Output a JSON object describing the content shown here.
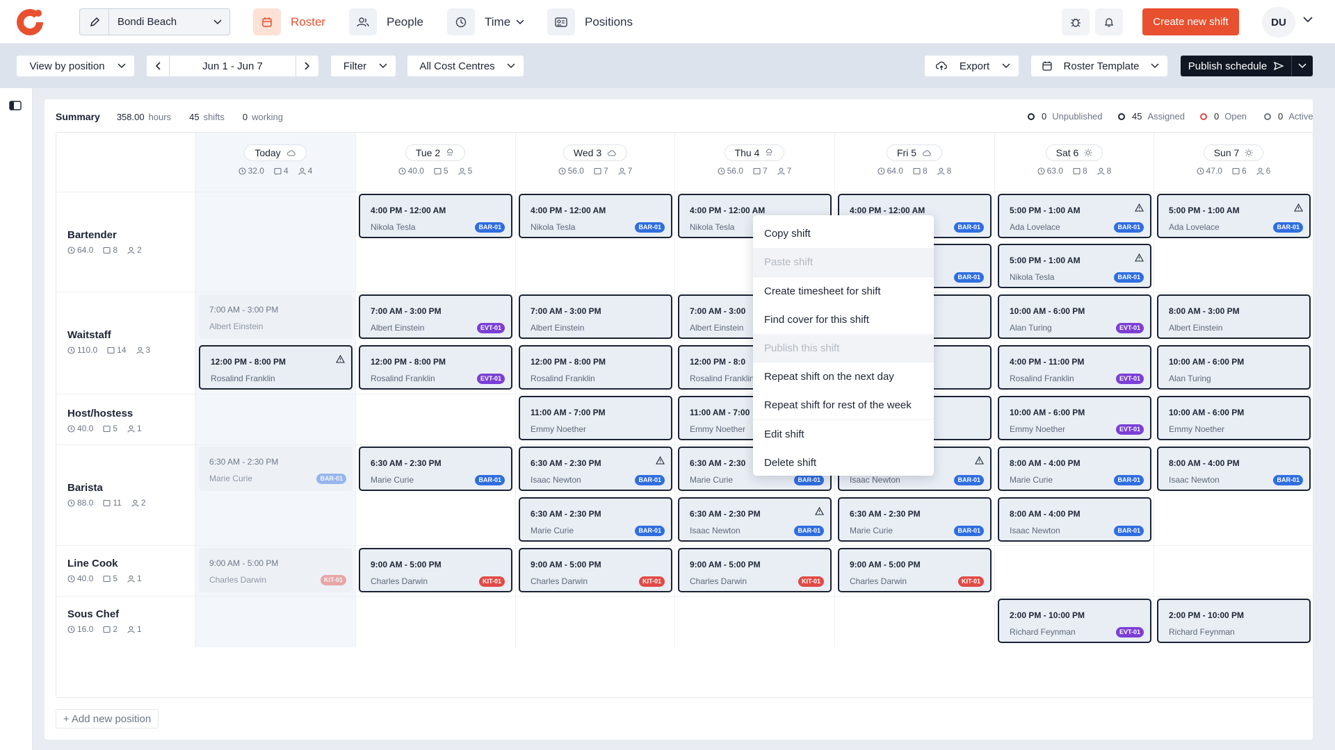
{
  "header": {
    "location": "Bondi Beach",
    "nav": [
      {
        "label": "Roster",
        "icon": "calendar-icon"
      },
      {
        "label": "People",
        "icon": "users-icon"
      },
      {
        "label": "Time",
        "icon": "clock-icon"
      },
      {
        "label": "Positions",
        "icon": "id-card-icon"
      }
    ],
    "create_label": "Create new shift",
    "avatar": "DU",
    "accent": "#e8502f"
  },
  "toolbar": {
    "view": "View by position",
    "date_range": "Jun 1 - Jun 7",
    "filter": "Filter",
    "cost_centres": "All Cost Centres",
    "export": "Export",
    "template": "Roster Template",
    "publish": "Publish schedule"
  },
  "summary": {
    "title": "Summary",
    "hours": "358.00",
    "hours_label": "hours",
    "shifts": "45",
    "shifts_label": "shifts",
    "working": "0",
    "working_label": "working",
    "statuses": [
      {
        "n": "0",
        "label": "Unpublished",
        "color": "#1d2433"
      },
      {
        "n": "45",
        "label": "Assigned",
        "color": "#1d2433"
      },
      {
        "n": "0",
        "label": "Open",
        "color": "#e24a45"
      },
      {
        "n": "0",
        "label": "Active",
        "color": "#6c7585"
      }
    ]
  },
  "days": [
    {
      "label": "Today",
      "hours": "32.0",
      "shifts": "4",
      "people": "4"
    },
    {
      "label": "Tue 2",
      "hours": "40.0",
      "shifts": "5",
      "people": "5"
    },
    {
      "label": "Wed 3",
      "hours": "56.0",
      "shifts": "7",
      "people": "7"
    },
    {
      "label": "Thu 4",
      "hours": "56.0",
      "shifts": "7",
      "people": "7"
    },
    {
      "label": "Fri 5",
      "hours": "64.0",
      "shifts": "8",
      "people": "8"
    },
    {
      "label": "Sat 6",
      "hours": "63.0",
      "shifts": "8",
      "people": "8"
    },
    {
      "label": "Sun 7",
      "hours": "47.0",
      "shifts": "6",
      "people": "6"
    }
  ],
  "positions": [
    {
      "name": "Bartender",
      "hours": "64.0",
      "shifts": "8",
      "people": "2"
    },
    {
      "name": "Waitstaff",
      "hours": "110.0",
      "shifts": "14",
      "people": "3"
    },
    {
      "name": "Host/hostess",
      "hours": "40.0",
      "shifts": "5",
      "people": "1"
    },
    {
      "name": "Barista",
      "hours": "88.0",
      "shifts": "11",
      "people": "2"
    },
    {
      "name": "Line Cook",
      "hours": "40.0",
      "shifts": "5",
      "people": "1"
    },
    {
      "name": "Sous Chef",
      "hours": "16.0",
      "shifts": "2",
      "people": "1"
    }
  ],
  "shifts": [
    {
      "time": "4:00 PM - 12:00 AM",
      "name": "Nikola Tesla",
      "tag": "BAR-01",
      "tagtype": "bar"
    },
    {
      "time": "4:00 PM - 12:00 AM",
      "name": "Nikola Tesla",
      "tag": "BAR-01",
      "tagtype": "bar"
    },
    {
      "time": "4:00 PM - 12:00 AM",
      "name": "Nikola Tesla",
      "tag": "",
      "tagtype": ""
    },
    {
      "time": "4:00 PM - 12:00 AM",
      "name": "",
      "tag": "BAR-01",
      "tagtype": "bar"
    },
    {
      "time": "",
      "name": "",
      "tag": "BAR-01",
      "tagtype": "bar"
    },
    {
      "time": "5:00 PM - 1:00 AM",
      "name": "Ada Lovelace",
      "tag": "BAR-01",
      "tagtype": "bar"
    },
    {
      "time": "5:00 PM - 1:00 AM",
      "name": "Nikola Tesla",
      "tag": "BAR-01",
      "tagtype": "bar"
    },
    {
      "time": "5:00 PM - 1:00 AM",
      "name": "Ada Lovelace",
      "tag": "BAR-01",
      "tagtype": "bar"
    },
    {
      "time": "7:00 AM - 3:00 PM",
      "name": "Albert Einstein",
      "tag": "",
      "tagtype": ""
    },
    {
      "time": "12:00 PM - 8:00 PM",
      "name": "Rosalind Franklin",
      "tag": "",
      "tagtype": ""
    },
    {
      "time": "7:00 AM - 3:00 PM",
      "name": "Albert Einstein",
      "tag": "EVT-01",
      "tagtype": "evt"
    },
    {
      "time": "12:00 PM - 8:00 PM",
      "name": "Rosalind Franklin",
      "tag": "EVT-01",
      "tagtype": "evt"
    },
    {
      "time": "7:00 AM - 3:00 PM",
      "name": "Albert Einstein",
      "tag": "",
      "tagtype": ""
    },
    {
      "time": "12:00 PM - 8:00 PM",
      "name": "Rosalind Franklin",
      "tag": "",
      "tagtype": ""
    },
    {
      "time": "7:00 AM - 3:00",
      "name": "Albert Einstein",
      "tag": "",
      "tagtype": ""
    },
    {
      "time": "12:00 PM - 8:0",
      "name": "Rosalind Franklin",
      "tag": "",
      "tagtype": ""
    },
    {
      "time": "",
      "name": "",
      "tag": "",
      "tagtype": ""
    },
    {
      "time": "",
      "name": "",
      "tag": "",
      "tagtype": ""
    },
    {
      "time": "10:00 AM - 6:00 PM",
      "name": "Alan Turing",
      "tag": "EVT-01",
      "tagtype": "evt"
    },
    {
      "time": "4:00 PM - 11:00 PM",
      "name": "Rosalind Franklin",
      "tag": "EVT-01",
      "tagtype": "evt"
    },
    {
      "time": "8:00 AM - 3:00 PM",
      "name": "Albert Einstein",
      "tag": "",
      "tagtype": ""
    },
    {
      "time": "10:00 AM - 6:00 PM",
      "name": "Alan Turing",
      "tag": "",
      "tagtype": ""
    },
    {
      "time": "11:00 AM - 7:00 PM",
      "name": "Emmy Noether",
      "tag": "",
      "tagtype": ""
    },
    {
      "time": "11:00 AM - 7:00",
      "name": "Emmy Noether",
      "tag": "",
      "tagtype": ""
    },
    {
      "time": "",
      "name": "",
      "tag": "",
      "tagtype": ""
    },
    {
      "time": "10:00 AM - 6:00 PM",
      "name": "Emmy Noether",
      "tag": "EVT-01",
      "tagtype": "evt"
    },
    {
      "time": "10:00 AM - 6:00 PM",
      "name": "Emmy Noether",
      "tag": "",
      "tagtype": ""
    },
    {
      "time": "6:30 AM - 2:30 PM",
      "name": "Marie Curie",
      "tag": "BAR-01",
      "tagtype": "bar"
    },
    {
      "time": "6:30 AM - 2:30 PM",
      "name": "Marie Curie",
      "tag": "BAR-01",
      "tagtype": "bar"
    },
    {
      "time": "6:30 AM - 2:30 PM",
      "name": "Isaac Newton",
      "tag": "BAR-01",
      "tagtype": "bar"
    },
    {
      "time": "6:30 AM - 2:30 PM",
      "name": "Marie Curie",
      "tag": "BAR-01",
      "tagtype": "bar"
    },
    {
      "time": "6:30 AM - 2:30",
      "name": "Marie Curie",
      "tag": "BAR-01",
      "tagtype": "bar"
    },
    {
      "time": "6:30 AM - 2:30 PM",
      "name": "Isaac Newton",
      "tag": "BAR-01",
      "tagtype": "bar"
    },
    {
      "time": "",
      "name": "Isaac Newton",
      "tag": "BAR-01",
      "tagtype": "bar"
    },
    {
      "time": "6:30 AM - 2:30 PM",
      "name": "Marie Curie",
      "tag": "BAR-01",
      "tagtype": "bar"
    },
    {
      "time": "8:00 AM - 4:00 PM",
      "name": "Marie Curie",
      "tag": "BAR-01",
      "tagtype": "bar"
    },
    {
      "time": "8:00 AM - 4:00 PM",
      "name": "Isaac Newton",
      "tag": "BAR-01",
      "tagtype": "bar"
    },
    {
      "time": "8:00 AM - 4:00 PM",
      "name": "Isaac Newton",
      "tag": "BAR-01",
      "tagtype": "bar"
    },
    {
      "time": "9:00 AM - 5:00 PM",
      "name": "Charles Darwin",
      "tag": "KIT-01",
      "tagtype": "kit"
    },
    {
      "time": "9:00 AM - 5:00 PM",
      "name": "Charles Darwin",
      "tag": "KIT-01",
      "tagtype": "kit"
    },
    {
      "time": "9:00 AM - 5:00 PM",
      "name": "Charles Darwin",
      "tag": "KIT-01",
      "tagtype": "kit"
    },
    {
      "time": "9:00 AM - 5:00 PM",
      "name": "Charles Darwin",
      "tag": "KIT-01",
      "tagtype": "kit"
    },
    {
      "time": "9:00 AM - 5:00 PM",
      "name": "Charles Darwin",
      "tag": "KIT-01",
      "tagtype": "kit"
    },
    {
      "time": "2:00 PM - 10:00 PM",
      "name": "Richard Feynman",
      "tag": "EVT-01",
      "tagtype": "evt"
    },
    {
      "time": "2:00 PM - 10:00 PM",
      "name": "Richard Feynman",
      "tag": "",
      "tagtype": ""
    }
  ],
  "context_menu": [
    {
      "label": "Copy shift",
      "disabled": false
    },
    {
      "label": "Paste shift",
      "disabled": true
    },
    {
      "label": "Create timesheet for shift",
      "disabled": false
    },
    {
      "label": "Find cover for this shift",
      "disabled": false
    },
    {
      "label": "Publish this shift",
      "disabled": true
    },
    {
      "label": "Repeat shift on the next day",
      "disabled": false
    },
    {
      "label": "Repeat shift for rest of the week",
      "disabled": false
    },
    {
      "label": "Edit shift",
      "disabled": false
    },
    {
      "label": "Delete shift",
      "disabled": false
    }
  ],
  "add_position": "+ Add new position"
}
